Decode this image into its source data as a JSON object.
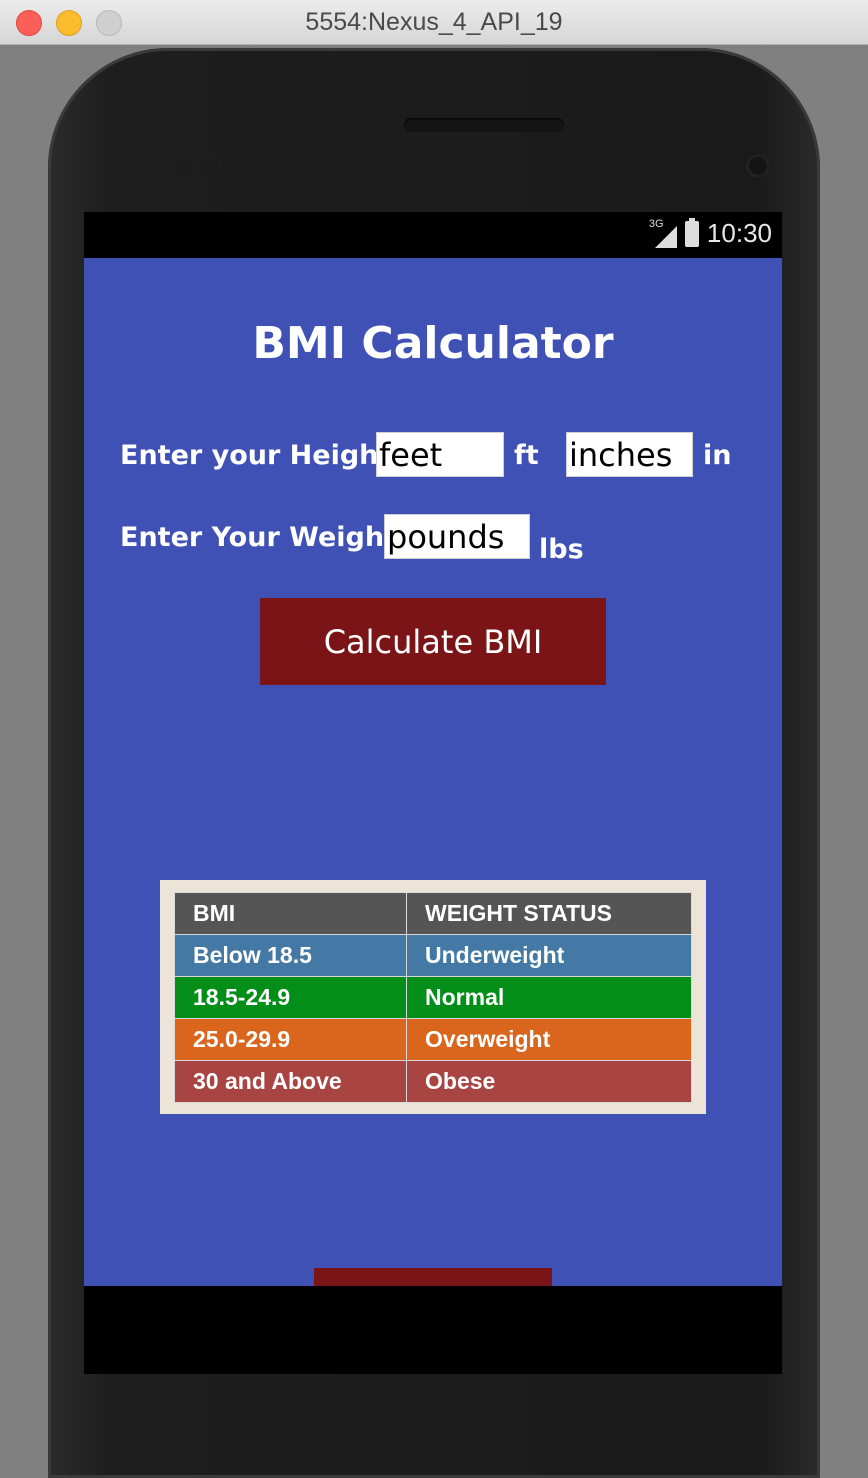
{
  "window": {
    "title": "5554:Nexus_4_API_19"
  },
  "statusbar": {
    "network": "3G",
    "time": "10:30"
  },
  "app": {
    "title": "BMI Calculator",
    "height_label": "Enter your Height",
    "feet_placeholder": "feet",
    "feet_unit": "ft",
    "inches_placeholder": "inches",
    "inches_unit": "in",
    "weight_label": "Enter Your Weight",
    "pounds_placeholder": "pounds",
    "pounds_unit": "lbs",
    "calculate_button": "Calculate BMI"
  },
  "bmi_table": {
    "headers": [
      "BMI",
      "WEIGHT STATUS"
    ],
    "rows": [
      {
        "bmi": "Below 18.5",
        "status": "Underweight",
        "color": "#4579a5"
      },
      {
        "bmi": "18.5-24.9",
        "status": "Normal",
        "color": "#028e18"
      },
      {
        "bmi": "25.0-29.9",
        "status": "Overweight",
        "color": "#d9661c"
      },
      {
        "bmi": "30 and Above",
        "status": "Obese",
        "color": "#a84543"
      }
    ],
    "header_color": "#555555"
  },
  "colors": {
    "app_background": "#3f51b5",
    "button": "#7b1416"
  }
}
